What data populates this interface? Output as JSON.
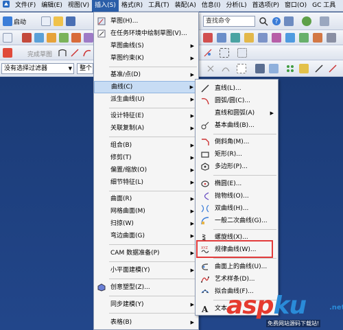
{
  "menubar": {
    "items": [
      "文件(F)",
      "编辑(E)",
      "视图(V)",
      "插入(S)",
      "格式(R)",
      "工具(T)",
      "装配(A)",
      "信息(I)",
      "分析(L)",
      "首选项(P)",
      "窗口(O)",
      "GC 工具"
    ]
  },
  "toolbar": {
    "start_label": "启动",
    "command_finder_placeholder": "查找命令",
    "complete_sketch_label": "完成草图",
    "filter_label": "没有选择过滤器",
    "assembly_scope_label": "整个"
  },
  "insert_menu": {
    "items": [
      {
        "label": "草图(H)..."
      },
      {
        "label": "在任务环境中绘制草图(V)..."
      },
      {
        "label": "草图曲线(S)"
      },
      {
        "label": "草图约束(K)"
      },
      {
        "label": "基准/点(D)"
      },
      {
        "label": "曲线(C)"
      },
      {
        "label": "派生曲线(U)"
      },
      {
        "label": "设计特征(E)"
      },
      {
        "label": "关联复制(A)"
      },
      {
        "label": "组合(B)"
      },
      {
        "label": "修剪(T)"
      },
      {
        "label": "偏置/缩放(O)"
      },
      {
        "label": "细节特征(L)"
      },
      {
        "label": "曲面(R)"
      },
      {
        "label": "网格曲面(M)"
      },
      {
        "label": "扫掠(W)"
      },
      {
        "label": "弯边曲面(G)"
      },
      {
        "label": "CAM 数据准备(P)"
      },
      {
        "label": "小平面建模(Y)"
      },
      {
        "label": "创意塑型(Z)..."
      },
      {
        "label": "同步建模(Y)"
      },
      {
        "label": "表格(B)"
      }
    ]
  },
  "curve_submenu": {
    "items": [
      {
        "label": "直线(L)..."
      },
      {
        "label": "圆弧/圆(C)..."
      },
      {
        "label": "直线和圆弧(A)"
      },
      {
        "label": "基本曲线(B)..."
      },
      {
        "label": "倒斜角(M)..."
      },
      {
        "label": "矩形(R)..."
      },
      {
        "label": "多边形(P)..."
      },
      {
        "label": "椭圆(E)..."
      },
      {
        "label": "抛物线(O)..."
      },
      {
        "label": "双曲线(H)..."
      },
      {
        "label": "一般二次曲线(G)..."
      },
      {
        "label": "螺旋线(X)..."
      },
      {
        "label": "规律曲线(W)..."
      },
      {
        "label": "曲面上的曲线(U)..."
      },
      {
        "label": "艺术样条(D)..."
      },
      {
        "label": "拟合曲线(F)..."
      },
      {
        "label": "文本"
      }
    ]
  },
  "watermark": {
    "brand_part1": "asp",
    "brand_part2": "ku",
    "brand_part3": ".net",
    "tagline": "免费网站源码下载站!"
  },
  "colors": {
    "menu_active": "#2b5ea8",
    "highlight_border": "#e23b3b",
    "canvas": "#1e3f7a",
    "menu_hover": "#c7dcf4"
  }
}
